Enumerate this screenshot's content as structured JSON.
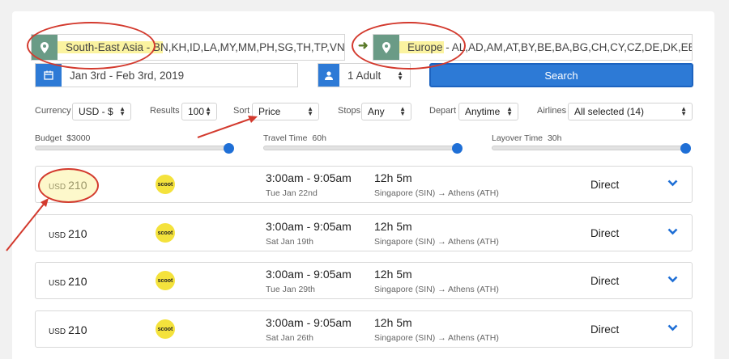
{
  "origin": {
    "value": "South-East Asia - BN,KH,ID,LA,MY,MM,PH,SG,TH,TP,VN",
    "icon": "map-pin-icon"
  },
  "destination": {
    "value": "Europe - AL,AD,AM,AT,BY,BE,BA,BG,CH,CY,CZ,DE,DK,EE,ES,FO",
    "icon": "map-pin-icon"
  },
  "dates": {
    "value": "Jan 3rd - Feb 3rd, 2019",
    "icon": "calendar-icon"
  },
  "passengers": {
    "value": "1 Adult",
    "icon": "user-icon"
  },
  "search_label": "Search",
  "filters": {
    "currency": {
      "label": "Currency",
      "value": "USD - $"
    },
    "results": {
      "label": "Results",
      "value": "100"
    },
    "sort": {
      "label": "Sort",
      "value": "Price"
    },
    "stops": {
      "label": "Stops",
      "value": "Any"
    },
    "depart": {
      "label": "Depart",
      "value": "Anytime"
    },
    "airlines": {
      "label": "Airlines",
      "value": "All selected (14)"
    }
  },
  "sliders": {
    "budget": {
      "label": "Budget",
      "value": "$3000",
      "level": 1.0
    },
    "travel_time": {
      "label": "Travel Time",
      "value": "60h",
      "level": 1.0
    },
    "layover_time": {
      "label": "Layover Time",
      "value": "30h",
      "level": 1.0
    }
  },
  "results": [
    {
      "currency": "USD",
      "price": "210",
      "airline": "scoot",
      "time": "3:00am - 9:05am",
      "date": "Tue Jan 22nd",
      "duration": "12h 5m",
      "route": "Singapore (SIN) → Athens (ATH)",
      "stops": "Direct"
    },
    {
      "currency": "USD",
      "price": "210",
      "airline": "scoot",
      "time": "3:00am - 9:05am",
      "date": "Sat Jan 19th",
      "duration": "12h 5m",
      "route": "Singapore (SIN) → Athens (ATH)",
      "stops": "Direct"
    },
    {
      "currency": "USD",
      "price": "210",
      "airline": "scoot",
      "time": "3:00am - 9:05am",
      "date": "Tue Jan 29th",
      "duration": "12h 5m",
      "route": "Singapore (SIN) → Athens (ATH)",
      "stops": "Direct"
    },
    {
      "currency": "USD",
      "price": "210",
      "airline": "scoot",
      "time": "3:00am - 9:05am",
      "date": "Sat Jan 26th",
      "duration": "12h 5m",
      "route": "Singapore (SIN) → Athens (ATH)",
      "stops": "Direct"
    }
  ],
  "colors": {
    "accent": "#2d7ad6",
    "pin_bg": "#6a9b86",
    "highlight": "#fbf3a0",
    "annotation": "#d33a2e"
  }
}
